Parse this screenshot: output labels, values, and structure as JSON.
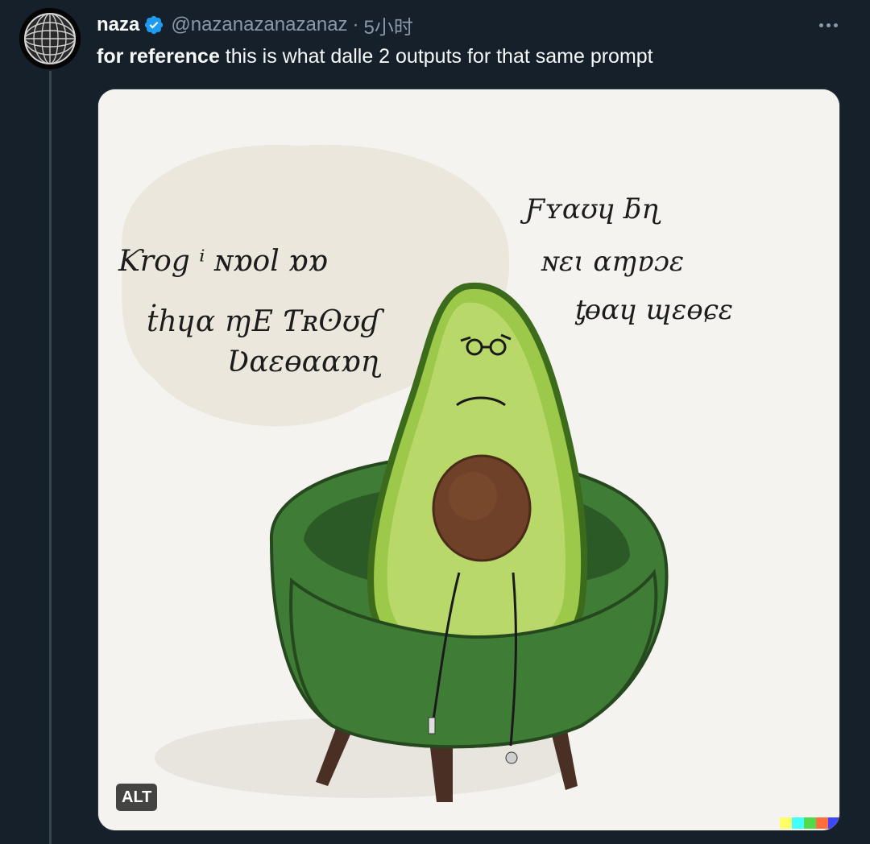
{
  "tweet": {
    "display_name": "naza",
    "handle": "@nazanazanazanaz",
    "separator": "·",
    "time": "5小时",
    "text_bold": "for reference",
    "text_rest": " this is what dalle 2 outputs for that same prompt",
    "verified": true
  },
  "icons": {
    "avatar": "disco-ball-globe-icon",
    "verified": "verified-badge-icon",
    "more": "more-horizontal-icon"
  },
  "media": {
    "alt_label": "ALT",
    "speech_bubble_left": [
      "Ƙrog ⁱ  ɴɒol ɒɒ",
      "ṫhɥɑ  ɱE  Ƭʀʘʊɠ",
      "Ʋɑɛɵɑɑɒɳ"
    ],
    "scribble_right": [
      "Ƒʏɑʊɥ  ƃɳ",
      "ɴɛɩ   ɑɱɐɔɛ",
      "ƫɵɑɥ  ɰɛɵɕɛ"
    ],
    "dalle_colors": [
      "#ffff66",
      "#42ffff",
      "#51da4c",
      "#ff6e3c",
      "#3c46ff"
    ]
  },
  "colors": {
    "background": "#15202b",
    "verified_blue": "#1d9bf0",
    "text_primary": "#f7f9f9",
    "text_secondary": "#8b98a5"
  }
}
